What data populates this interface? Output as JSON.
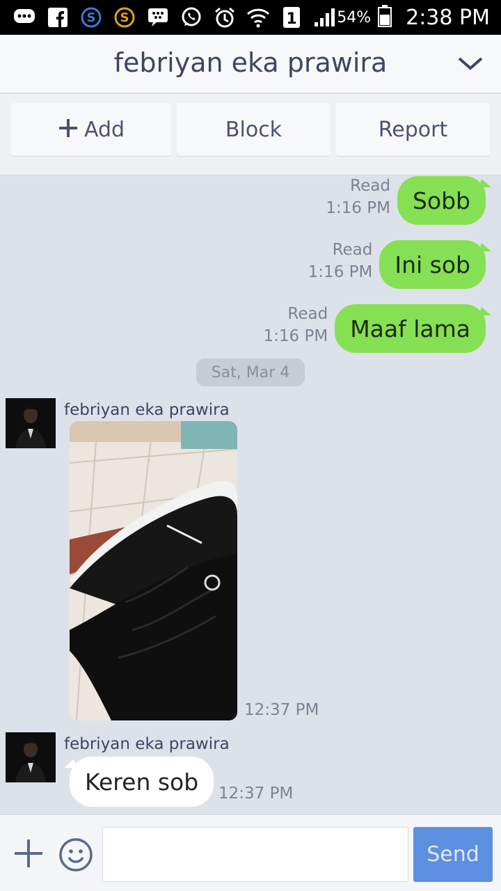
{
  "status_bar": {
    "battery_percent": "54%",
    "time": "2:38 PM",
    "sim_badge": "1",
    "icons": [
      "chat-bubble-icon",
      "facebook-icon",
      "blue-s-icon",
      "orange-s-icon",
      "bbm-icon",
      "whatsapp-icon",
      "alarm-icon",
      "wifi-icon",
      "sim-icon",
      "signal-icon",
      "battery-icon"
    ]
  },
  "header": {
    "title": "febriyan eka prawira",
    "menu_icon": "chevron-down-icon"
  },
  "actions": {
    "add_label": "Add",
    "block_label": "Block",
    "report_label": "Report"
  },
  "messages_out": [
    {
      "status": "Read",
      "time": "1:16 PM",
      "text": "Sobb"
    },
    {
      "status": "Read",
      "time": "1:16 PM",
      "text": "Ini sob"
    },
    {
      "status": "Read",
      "time": "1:16 PM",
      "text": "Maaf lama"
    }
  ],
  "date_divider": "Sat, Mar 4",
  "messages_in": [
    {
      "sender": "febriyan eka prawira",
      "type": "photo",
      "time": "12:37 PM"
    },
    {
      "sender": "febriyan eka prawira",
      "type": "text",
      "text": "Keren sob",
      "time": "12:37 PM"
    }
  ],
  "input": {
    "placeholder": "",
    "send_label": "Send"
  },
  "colors": {
    "outgoing_bubble": "#85e053",
    "incoming_bubble": "#ffffff",
    "chat_background": "#dde2ea",
    "send_button": "#5d8fe0",
    "header_text": "#3d4563"
  }
}
